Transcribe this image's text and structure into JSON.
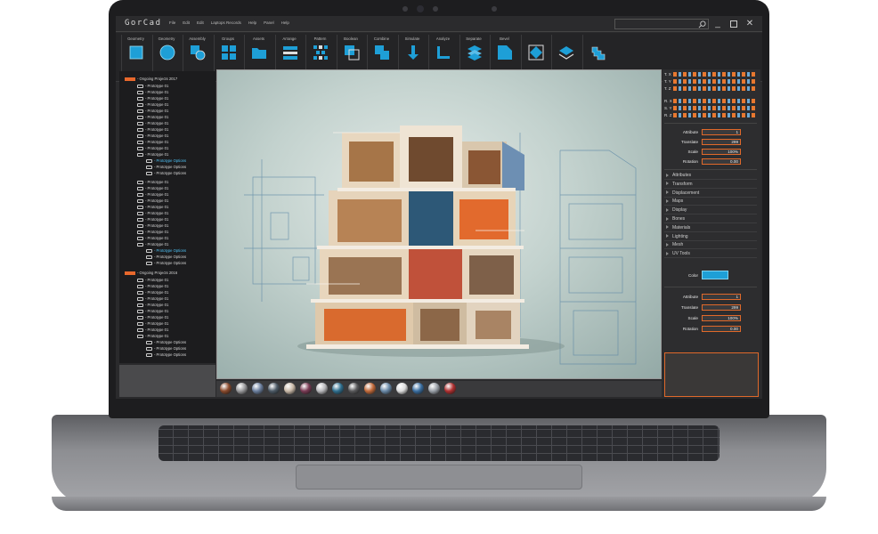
{
  "app": {
    "logo": "GorCad"
  },
  "menu": [
    "File",
    "Edit",
    "Edit",
    "Laptops Records",
    "Help",
    "Panel",
    "Help"
  ],
  "toolbar": [
    {
      "label": "Geometry",
      "icon": "square-icon"
    },
    {
      "label": "Geometry",
      "icon": "circle-icon"
    },
    {
      "label": "Assembly",
      "icon": "assembly-icon"
    },
    {
      "label": "Groups",
      "icon": "groups-icon"
    },
    {
      "label": "Assets",
      "icon": "folder-icon"
    },
    {
      "label": "Arrange",
      "icon": "arrange-icon"
    },
    {
      "label": "Pattern",
      "icon": "pattern-icon"
    },
    {
      "label": "Boolean",
      "icon": "boolean-icon"
    },
    {
      "label": "Combine",
      "icon": "combine-icon"
    },
    {
      "label": "Simulate",
      "icon": "simulate-icon"
    },
    {
      "label": "Analyze",
      "icon": "analyze-icon"
    },
    {
      "label": "Separate",
      "icon": "layers-icon"
    },
    {
      "label": "Bevel",
      "icon": "bevel-icon"
    },
    {
      "label": "",
      "icon": "diamond-frame-icon"
    },
    {
      "label": "",
      "icon": "stack-icon"
    },
    {
      "label": "",
      "icon": "puzzle-icon"
    }
  ],
  "tree": {
    "group1": {
      "title": "- Ongoing Projects 2017",
      "items": [
        "- Prototype 01",
        "- Prototype 01",
        "- Prototype 01",
        "- Prototype 01",
        "- Prototype 01",
        "- Prototype 01",
        "- Prototype 01",
        "- Prototype 01",
        "- Prototype 01",
        "- Prototype 01",
        "- Prototype 01",
        "- Prototype 01"
      ],
      "options1": [
        "- Prototype Options",
        "- Prototype Options",
        "- Prototype Options"
      ],
      "items2": [
        "- Prototype 01",
        "- Prototype 01",
        "- Prototype 01",
        "- Prototype 01",
        "- Prototype 01",
        "- Prototype 01",
        "- Prototype 01",
        "- Prototype 01",
        "- Prototype 01",
        "- Prototype 01",
        "- Prototype 01"
      ],
      "options2": [
        "- Prototype Options",
        "- Prototype Options",
        "- Prototype Options"
      ]
    },
    "group2": {
      "title": "- Ongoing Projects 2016",
      "items": [
        "- Prototype 01",
        "- Prototype 01",
        "- Prototype 01",
        "- Prototype 01",
        "- Prototype 01",
        "- Prototype 01",
        "- Prototype 01",
        "- Prototype 01",
        "- Prototype 01",
        "- Prototype 01"
      ],
      "options": [
        "- Prototype Options",
        "- Prototype Options",
        "- Prototype Options"
      ]
    }
  },
  "axes": {
    "top": [
      "T.",
      "T.",
      "T."
    ],
    "top_axes": [
      "X",
      "Y",
      "Z"
    ],
    "bottom": [
      "R.",
      "S.",
      "R."
    ],
    "bottom_axes": [
      "X",
      "Y",
      "Z"
    ]
  },
  "props1": {
    "attribute_label": "Attribute",
    "attribute_value": "1",
    "translate_label": "Translate",
    "translate_value": "299",
    "scale_label": "Scale",
    "scale_value": "100%",
    "rotation_label": "Rotation",
    "rotation_value": "0.00"
  },
  "sections": [
    "Attributes",
    "Transform",
    "Displacement",
    "Maps",
    "Display",
    "Bones",
    "Materials",
    "Lighting",
    "Mesh",
    "UV Tools"
  ],
  "color_label": "Color",
  "colors": {
    "swatch": "#1e9fd7",
    "accent": "#e0692a"
  },
  "props2": {
    "attribute_label": "Attribute",
    "attribute_value": "1",
    "translate_label": "Translate",
    "translate_value": "299",
    "scale_label": "Scale",
    "scale_value": "100%",
    "rotation_label": "Rotation",
    "rotation_value": "0.00"
  },
  "materials": [
    "#8a4a2c",
    "#9a9a9c",
    "#6b7f9e",
    "#4d5a66",
    "#c9b9a8",
    "#7a3b55",
    "#b8b8bb",
    "#2f6f8f",
    "#5a5a5c",
    "#c26a3a",
    "#6a8aa8",
    "#dcdcdc",
    "#3a6ea0",
    "#9aa0a8",
    "#b03030"
  ]
}
